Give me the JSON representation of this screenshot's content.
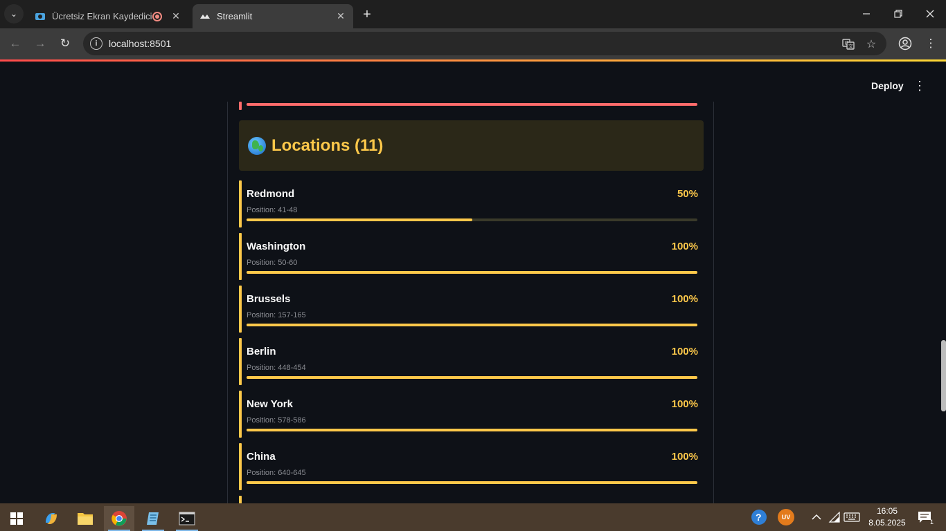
{
  "browser": {
    "tabs": [
      {
        "title": "Ücretsiz Ekran Kaydedici – V",
        "active": false,
        "recording": true
      },
      {
        "title": "Streamlit",
        "active": true,
        "recording": false
      }
    ],
    "url": "localhost:8501",
    "icons": {
      "tab_list": "chevron-down-icon",
      "new_tab": "plus-icon",
      "back": "arrow-left-icon",
      "forward": "arrow-right-icon",
      "reload": "reload-icon",
      "site_info": "info-icon",
      "translate": "translate-icon",
      "bookmark": "star-icon",
      "profile": "profile-icon",
      "menu": "kebab-icon"
    }
  },
  "app": {
    "deploy_label": "Deploy",
    "section": {
      "icon": "globe-icon",
      "title": "Locations (11)"
    },
    "previous_item_color": "#ff6b6b",
    "accent_color": "#fdc84a",
    "locations": [
      {
        "name": "Redmond",
        "percent_label": "50%",
        "position": "Position: 41-48",
        "progress": 0.5
      },
      {
        "name": "Washington",
        "percent_label": "100%",
        "position": "Position: 50-60",
        "progress": 1.0
      },
      {
        "name": "Brussels",
        "percent_label": "100%",
        "position": "Position: 157-165",
        "progress": 1.0
      },
      {
        "name": "Berlin",
        "percent_label": "100%",
        "position": "Position: 448-454",
        "progress": 1.0
      },
      {
        "name": "New York",
        "percent_label": "100%",
        "position": "Position: 578-586",
        "progress": 1.0
      },
      {
        "name": "China",
        "percent_label": "100%",
        "position": "Position: 640-645",
        "progress": 1.0
      }
    ]
  },
  "taskbar": {
    "apps": [
      "windows-start-icon",
      "copilot-icon",
      "file-explorer-icon",
      "chrome-icon",
      "notepad-icon",
      "terminal-icon"
    ],
    "tray": {
      "help_icon": "help-icon",
      "user_initials": "UV",
      "time": "16:05",
      "date": "8.05.2025",
      "notification_count": "1"
    }
  }
}
